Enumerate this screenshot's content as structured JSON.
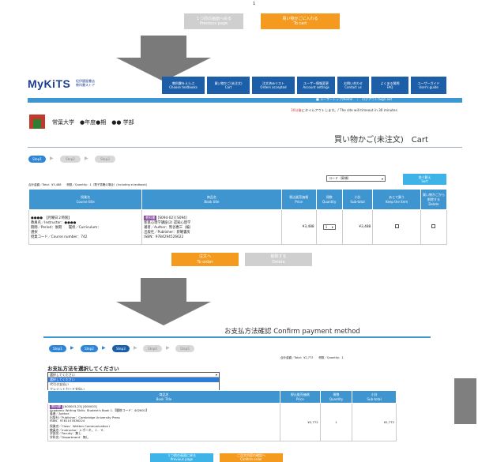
{
  "page_number": "1",
  "top_buttons": {
    "prev_jp": "１つ前の画面へ戻る",
    "prev_en": "Previous page",
    "cart_jp": "買い物かごに入れる",
    "cart_en": "To cart"
  },
  "header": {
    "logo": "MyKiTS",
    "logo_sub1": "紀伊國屋書店",
    "logo_sub2": "教科書ストア",
    "nav": [
      {
        "jp": "教科書をえらぶ",
        "en": "Choose textbooks"
      },
      {
        "jp": "買い物かご(未注文)",
        "en": "Cart"
      },
      {
        "jp": "注文済みリスト",
        "en": "Orders accepted"
      },
      {
        "jp": "ユーザー情報変更",
        "en": "Account settings"
      },
      {
        "jp": "お問い合わせ",
        "en": "Contact us"
      },
      {
        "jp": "よくある質問",
        "en": "FAQ"
      },
      {
        "jp": "ユーザーガイド",
        "en": "User's guide"
      }
    ],
    "links": "ユーザートップ/Home　｜　ログアウト/Sign out",
    "timeout_red": "30分後",
    "timeout_rest": "にタイムアウトします。/ The site will timeout in 30 minutes."
  },
  "univ": {
    "name": "常葉大学",
    "year": "●年度●期",
    "faculty": "●● 学部"
  },
  "cart": {
    "title": "買い物かご(未注文)　Cart",
    "steps": [
      "Step1",
      "Step2",
      "Step3"
    ],
    "summary": "合計金額／Total：¥3,488　　冊数／Quantity：1（電子書籍の場合）(Including e-textbook)",
    "sort_select": "コード（昇順）",
    "sort_button_jp": "並べ替え",
    "sort_button_en": "Sort",
    "headers": [
      {
        "jp": "授業名",
        "en": "Course title"
      },
      {
        "jp": "商品名",
        "en": "Book title"
      },
      {
        "jp": "税込販売価格",
        "en": "Price"
      },
      {
        "jp": "冊数",
        "en": "Quantity"
      },
      {
        "jp": "小計",
        "en": "Sub-total"
      },
      {
        "jp": "あとで買う",
        "en": "Keep the item"
      },
      {
        "jp": "買い物かごから削除する",
        "en": "Delete"
      }
    ],
    "row": {
      "course_line1": "●●●●　【月曜日２時限】",
      "course_line2": "教員名／Instructor：●●●●",
      "course_line3": "期間／Period：後期　　履修／Curriculum：",
      "course_line4": "選択",
      "course_line5": "授業コード／Course number：742",
      "badge": "教科書",
      "book_line1": "[S094-02] [S094]",
      "book_line2": "新基心理学講座(2) 認知心理学",
      "book_line3": "著者／Author：熊谷惠三（編）",
      "book_line4": "出版社／Publisher：新曜書房",
      "book_line5": "ISBN：9784294526622",
      "price": "¥3,488",
      "qty": "1",
      "subtotal": "¥3,488"
    },
    "order_jp": "注文へ",
    "order_en": "To order",
    "delete_jp": "削除する",
    "delete_en": "Delete"
  },
  "confirm": {
    "title": "お支払方法確認 Confirm payment method",
    "steps": [
      "Step1",
      "Step2",
      "Step3",
      "Step4",
      "Step5"
    ],
    "summary": "合計金額／Total：¥2,772　　冊数／Quantity：1",
    "select_label": "お支払方法を選択してください",
    "select_value": "選択してください",
    "options": [
      "選択してください",
      "代引き支払い",
      "クレジットカード支払い"
    ],
    "headers": [
      {
        "jp": "商品名",
        "en": "Book Title"
      },
      {
        "jp": "税込販売価格",
        "en": "Price"
      },
      {
        "jp": "冊数",
        "en": "Quantity"
      },
      {
        "jp": "小計",
        "en": "Sub-total"
      }
    ],
    "row": {
      "badge": "教科書",
      "book_line1": "[K00003-23] [K00003]",
      "book_line2": "Academic Writing Skills: Student's Book 1.【履修コード：402601】",
      "book_line3": "著者／Author：",
      "book_line4": "出版社／Publisher：Cambridge University Press",
      "book_line5": "ISBN：9781107636224",
      "class_line1": "授業名／Class：Written Communication I",
      "class_line2": "教員名／Instructor：レボーネ，Ｊ．Ｖ．",
      "class_line3": "学部名／Faculty：無し",
      "class_line4": "学科名／Department：無し",
      "price": "¥2,772",
      "qty": "1",
      "subtotal": "¥2,772"
    },
    "prev_jp": "１つ前の画面に戻る",
    "prev_en": "Previous page",
    "confirm_jp": "ご注文内容の確認へ",
    "confirm_en": "Confirm order"
  }
}
